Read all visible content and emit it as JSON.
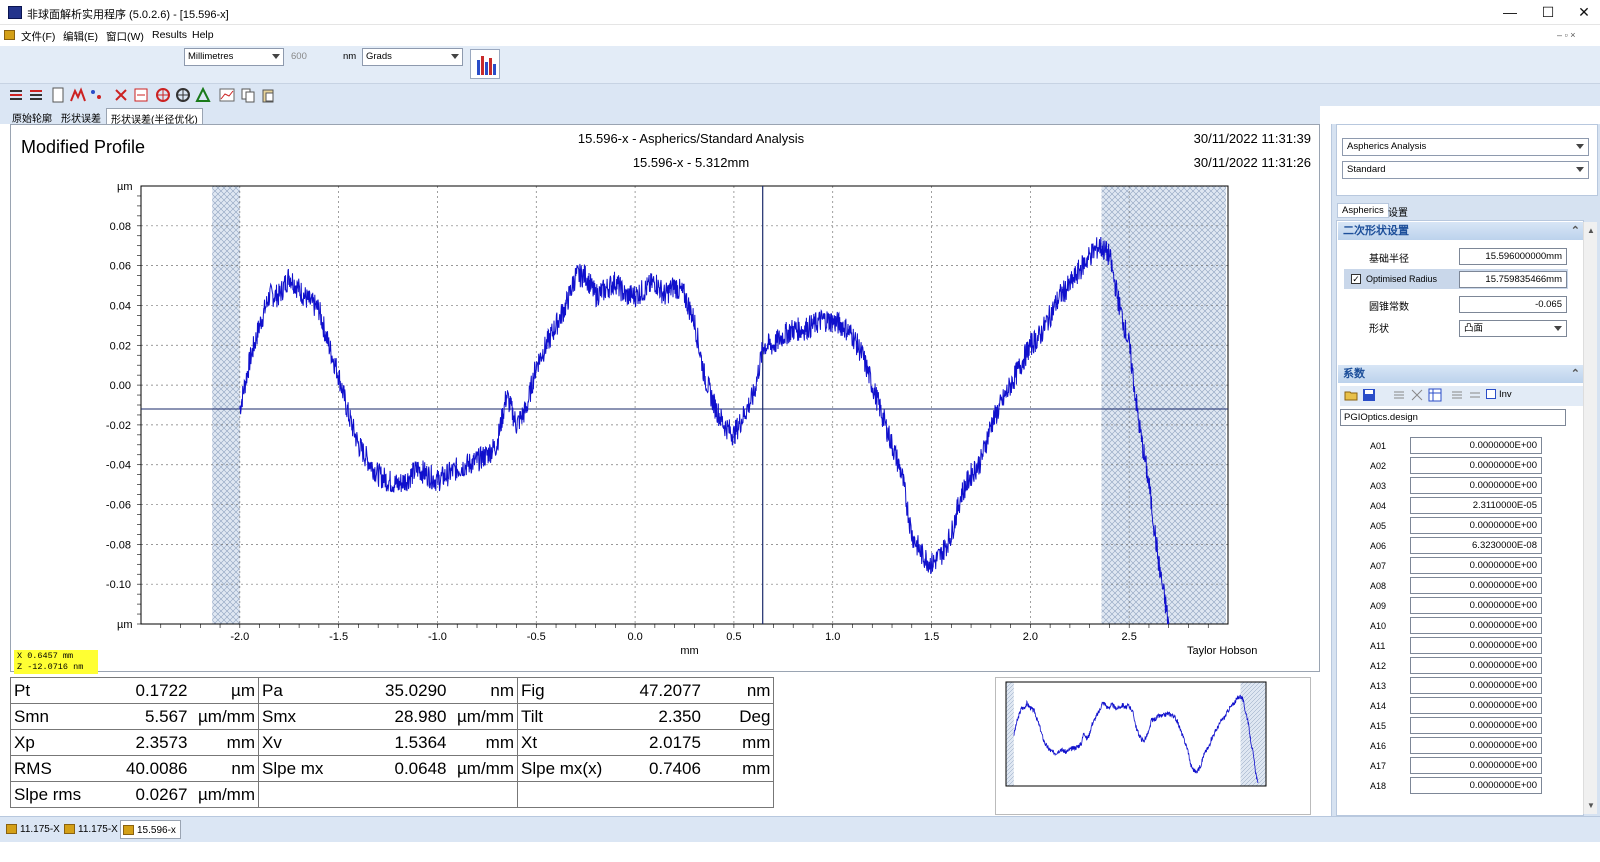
{
  "window": {
    "title": "非球面解析实用程序 (5.0.2.6) - [15.596-x]",
    "min": "—",
    "max": "☐",
    "close": "✕"
  },
  "menu": [
    "文件(F)",
    "编辑(E)",
    "窗口(W)",
    "Results",
    "Help"
  ],
  "toolbar": {
    "units": "Millimetres",
    "wavelength": "600",
    "wavelength_unit": "nm",
    "angle": "Grads"
  },
  "tabs": [
    "原始轮廓",
    "形状误差",
    "形状误差(半径优化)"
  ],
  "plot": {
    "panel_title": "Modified Profile",
    "title1": "15.596-x - Aspherics/Standard Analysis",
    "title2": "15.596-x - 5.312mm",
    "date1": "30/11/2022 11:31:39",
    "date2": "30/11/2022 11:31:26",
    "vendor": "Taylor Hobson",
    "unit_top": "µm",
    "unit_bottom": "µm"
  },
  "chart_data": {
    "type": "line",
    "xlabel": "mm",
    "ylabel": "µm",
    "xlim": [
      -2.5,
      3.0
    ],
    "ylim": [
      -0.12,
      0.1
    ],
    "x_ticks": [
      "-2.0",
      "-1.5",
      "-1.0",
      "-0.5",
      "0.0",
      "0.5",
      "1.0",
      "1.5",
      "2.0",
      "2.5"
    ],
    "y_ticks": [
      "0.08",
      "0.06",
      "0.04",
      "0.02",
      "0.00",
      "-0.02",
      "-0.04",
      "-0.06",
      "-0.08",
      "-0.10"
    ],
    "excluded_regions": [
      [
        -2.14,
        -2.0
      ],
      [
        2.36,
        2.99
      ]
    ],
    "cursor_x": 0.6457,
    "hline_y": -0.012,
    "color": "#1010cc",
    "series": [
      {
        "x": [
          -2.0,
          -1.95,
          -1.9,
          -1.85,
          -1.8,
          -1.75,
          -1.7,
          -1.65,
          -1.6,
          -1.55,
          -1.5,
          -1.45,
          -1.4,
          -1.35,
          -1.3,
          -1.25,
          -1.2,
          -1.15,
          -1.1,
          -1.05,
          -1.0,
          -0.95,
          -0.9,
          -0.85,
          -0.8,
          -0.75,
          -0.7,
          -0.65,
          -0.6,
          -0.55,
          -0.5,
          -0.45,
          -0.4,
          -0.35,
          -0.3,
          -0.25,
          -0.2,
          -0.15,
          -0.1,
          -0.05,
          0.0,
          0.05,
          0.1,
          0.15,
          0.2,
          0.25,
          0.3,
          0.35,
          0.4,
          0.45,
          0.5,
          0.55,
          0.6,
          0.65,
          0.7,
          0.75,
          0.8,
          0.85,
          0.9,
          0.95,
          1.0,
          1.05,
          1.1,
          1.15,
          1.2,
          1.25,
          1.3,
          1.35,
          1.4,
          1.45,
          1.5,
          1.55,
          1.6,
          1.65,
          1.7,
          1.75,
          1.8,
          1.85,
          1.9,
          1.95,
          2.0,
          2.05,
          2.1,
          2.15,
          2.2,
          2.25,
          2.3,
          2.35,
          2.4,
          2.45,
          2.5,
          2.55,
          2.6,
          2.65,
          2.7
        ],
        "y": [
          -0.012,
          0.012,
          0.03,
          0.045,
          0.045,
          0.055,
          0.048,
          0.042,
          0.038,
          0.02,
          0.005,
          -0.015,
          -0.03,
          -0.038,
          -0.045,
          -0.048,
          -0.05,
          -0.047,
          -0.042,
          -0.045,
          -0.048,
          -0.045,
          -0.042,
          -0.04,
          -0.038,
          -0.035,
          -0.03,
          -0.005,
          -0.02,
          -0.012,
          0.01,
          0.02,
          0.03,
          0.04,
          0.055,
          0.055,
          0.045,
          0.048,
          0.052,
          0.045,
          0.045,
          0.048,
          0.052,
          0.045,
          0.05,
          0.045,
          0.032,
          0.005,
          -0.01,
          -0.02,
          -0.025,
          -0.015,
          -0.005,
          0.02,
          0.02,
          0.025,
          0.028,
          0.028,
          0.03,
          0.033,
          0.032,
          0.03,
          0.025,
          0.015,
          0.0,
          -0.015,
          -0.03,
          -0.045,
          -0.075,
          -0.085,
          -0.09,
          -0.085,
          -0.075,
          -0.055,
          -0.045,
          -0.038,
          -0.02,
          -0.01,
          0.0,
          0.01,
          0.02,
          0.025,
          0.035,
          0.045,
          0.05,
          0.058,
          0.065,
          0.07,
          0.065,
          0.04,
          0.02,
          -0.02,
          -0.05,
          -0.09,
          -0.12
        ]
      }
    ]
  },
  "coords": {
    "x": "X   0.6457 mm",
    "z": "Z -12.0716 nm"
  },
  "stats": [
    [
      {
        "n": "Pt",
        "v": "0.1722",
        "u": "µm"
      },
      {
        "n": "Pa",
        "v": "35.0290",
        "u": "nm"
      },
      {
        "n": "Fig",
        "v": "47.2077",
        "u": "nm"
      }
    ],
    [
      {
        "n": "Smn",
        "v": "5.567",
        "u": "µm/mm"
      },
      {
        "n": "Smx",
        "v": "28.980",
        "u": "µm/mm"
      },
      {
        "n": "Tilt",
        "v": "2.350",
        "u": "Deg"
      }
    ],
    [
      {
        "n": "Xp",
        "v": "2.3573",
        "u": "mm"
      },
      {
        "n": "Xv",
        "v": "1.5364",
        "u": "mm"
      },
      {
        "n": "Xt",
        "v": "2.0175",
        "u": "mm"
      }
    ],
    [
      {
        "n": "RMS",
        "v": "40.0086",
        "u": "nm"
      },
      {
        "n": "Slpe mx",
        "v": "0.0648",
        "u": "µm/mm"
      },
      {
        "n": "Slpe mx(x)",
        "v": "0.7406",
        "u": "mm"
      }
    ],
    [
      {
        "n": "Slpe rms",
        "v": "0.0267",
        "u": "µm/mm"
      },
      {
        "n": "",
        "v": "",
        "u": ""
      },
      {
        "n": "",
        "v": "",
        "u": ""
      }
    ]
  ],
  "right": {
    "analysis": "Aspherics Analysis",
    "mode": "Standard",
    "tabs": [
      "Aspherics",
      "设置"
    ],
    "sec1": "二次形状设置",
    "base_radius_label": "基础半径",
    "base_radius": "15.596000000mm",
    "opt_label": "Optimised Radius",
    "opt_value": "15.759835466mm",
    "conic_label": "圆锥常数",
    "conic": "-0.065",
    "shape_label": "形状",
    "shape": "凸面",
    "sec2": "系数",
    "inv": "Inv",
    "design": "PGIOptics.design"
  },
  "coefs": [
    {
      "n": "A01",
      "v": "0.0000000E+00"
    },
    {
      "n": "A02",
      "v": "0.0000000E+00"
    },
    {
      "n": "A03",
      "v": "0.0000000E+00"
    },
    {
      "n": "A04",
      "v": "2.3110000E-05"
    },
    {
      "n": "A05",
      "v": "0.0000000E+00"
    },
    {
      "n": "A06",
      "v": "6.3230000E-08"
    },
    {
      "n": "A07",
      "v": "0.0000000E+00"
    },
    {
      "n": "A08",
      "v": "0.0000000E+00"
    },
    {
      "n": "A09",
      "v": "0.0000000E+00"
    },
    {
      "n": "A10",
      "v": "0.0000000E+00"
    },
    {
      "n": "A11",
      "v": "0.0000000E+00"
    },
    {
      "n": "A12",
      "v": "0.0000000E+00"
    },
    {
      "n": "A13",
      "v": "0.0000000E+00"
    },
    {
      "n": "A14",
      "v": "0.0000000E+00"
    },
    {
      "n": "A15",
      "v": "0.0000000E+00"
    },
    {
      "n": "A16",
      "v": "0.0000000E+00"
    },
    {
      "n": "A17",
      "v": "0.0000000E+00"
    },
    {
      "n": "A18",
      "v": "0.0000000E+00"
    }
  ],
  "taskbar": [
    "11.175-X",
    "11.175-X",
    "15.596-x"
  ]
}
